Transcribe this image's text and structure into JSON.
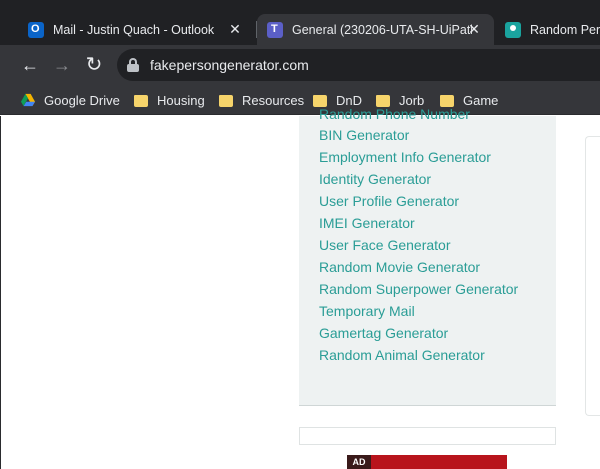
{
  "browser": {
    "tabs": [
      {
        "title": "Mail - Justin Quach - Outlook",
        "icon": "outlook-icon",
        "active": false
      },
      {
        "title": "General (230206-UTA-SH-UiPath)",
        "icon": "teams-icon",
        "active": true
      },
      {
        "title": "Random Person",
        "icon": "person-icon",
        "active": false
      }
    ],
    "close_glyph": "✕",
    "back_glyph": "←",
    "forward_glyph": "→",
    "reload_glyph": "↻",
    "url": "fakepersongenerator.com",
    "bookmarks": [
      {
        "label": "Google Drive",
        "icon": "google-drive-icon"
      },
      {
        "label": "Housing",
        "icon": "folder-icon"
      },
      {
        "label": "Resources",
        "icon": "folder-icon"
      },
      {
        "label": "DnD",
        "icon": "folder-icon"
      },
      {
        "label": "Jorb",
        "icon": "folder-icon"
      },
      {
        "label": "Game",
        "icon": "folder-icon"
      }
    ]
  },
  "sidebar": {
    "partial_link": "Random Phone Number",
    "links": [
      "BIN Generator",
      "Employment Info Generator",
      "Identity Generator",
      "User Profile Generator",
      "IMEI Generator",
      "User Face Generator",
      "Random Movie Generator",
      "Random Superpower Generator",
      "Temporary Mail",
      "Gamertag Generator",
      "Random Animal Generator"
    ]
  },
  "ad": {
    "label": "AD"
  },
  "colors": {
    "link": "#2a9d96",
    "sidebar_bg": "#eef2f2",
    "chrome_dark": "#202124",
    "chrome_toolbar": "#35363a",
    "ad_red": "#b8141c"
  }
}
